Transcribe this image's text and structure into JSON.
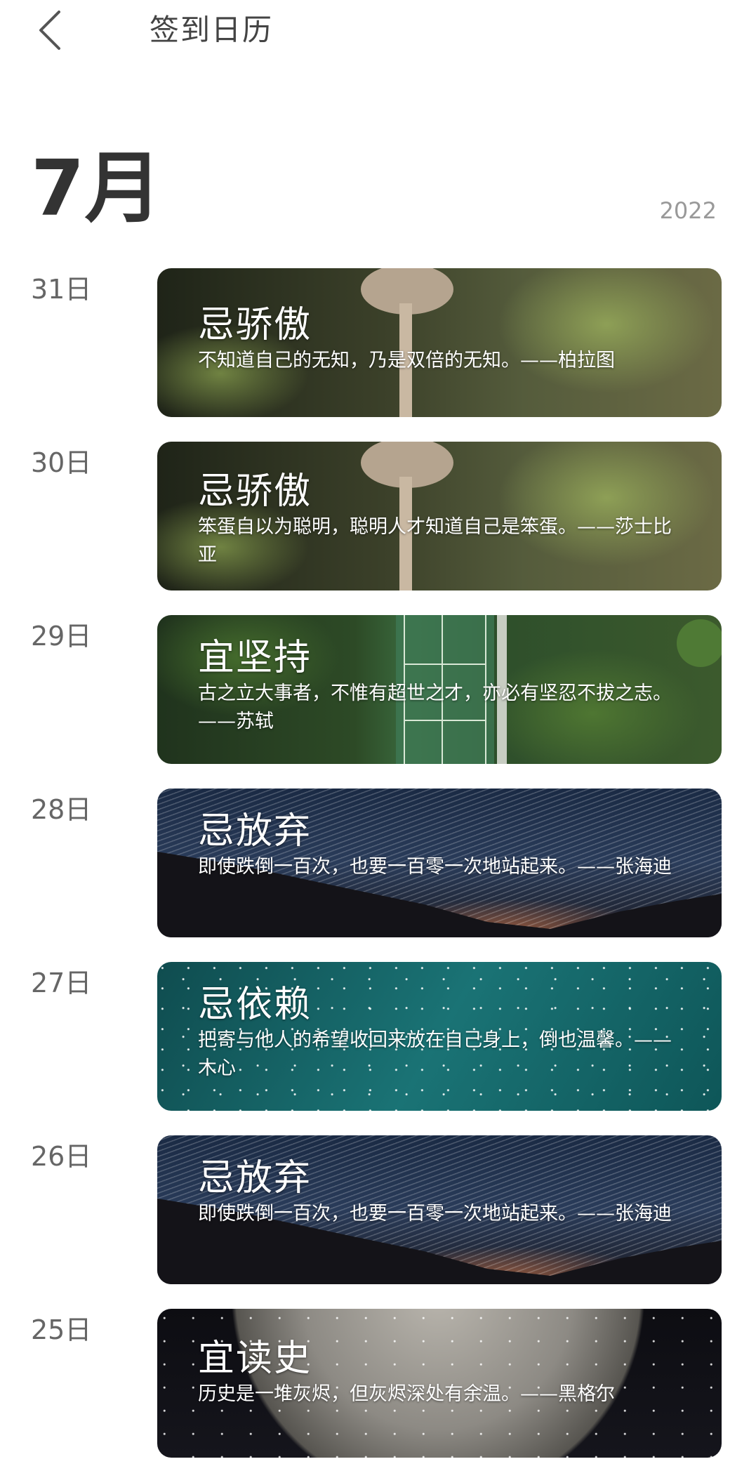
{
  "header": {
    "title": "签到日历"
  },
  "calendar": {
    "month": "7月",
    "year": "2022"
  },
  "entries": [
    {
      "day": "31日",
      "title": "忌骄傲",
      "quote": "不知道自己的无知，乃是双倍的无知。——柏拉图",
      "image": "mushroom"
    },
    {
      "day": "30日",
      "title": "忌骄傲",
      "quote": "笨蛋自以为聪明，聪明人才知道自己是笨蛋。——莎士比亚",
      "image": "mushroom"
    },
    {
      "day": "29日",
      "title": "宜坚持",
      "quote": "古之立大事者，不惟有超世之才，亦必有坚忍不拔之志。——苏轼",
      "image": "tennis-court-forest"
    },
    {
      "day": "28日",
      "title": "忌放弃",
      "quote": "即使跌倒一百次，也要一百零一次地站起来。——张海迪",
      "image": "star-trails"
    },
    {
      "day": "27日",
      "title": "忌依赖",
      "quote": "把寄与他人的希望收回来放在自己身上，倒也温馨。——木心",
      "image": "teal-sparkles"
    },
    {
      "day": "26日",
      "title": "忌放弃",
      "quote": "即使跌倒一百次，也要一百零一次地站起来。——张海迪",
      "image": "star-trails"
    },
    {
      "day": "25日",
      "title": "宜读史",
      "quote": "历史是一堆灰烬，但灰烬深处有余温。——黑格尔",
      "image": "moon"
    }
  ]
}
